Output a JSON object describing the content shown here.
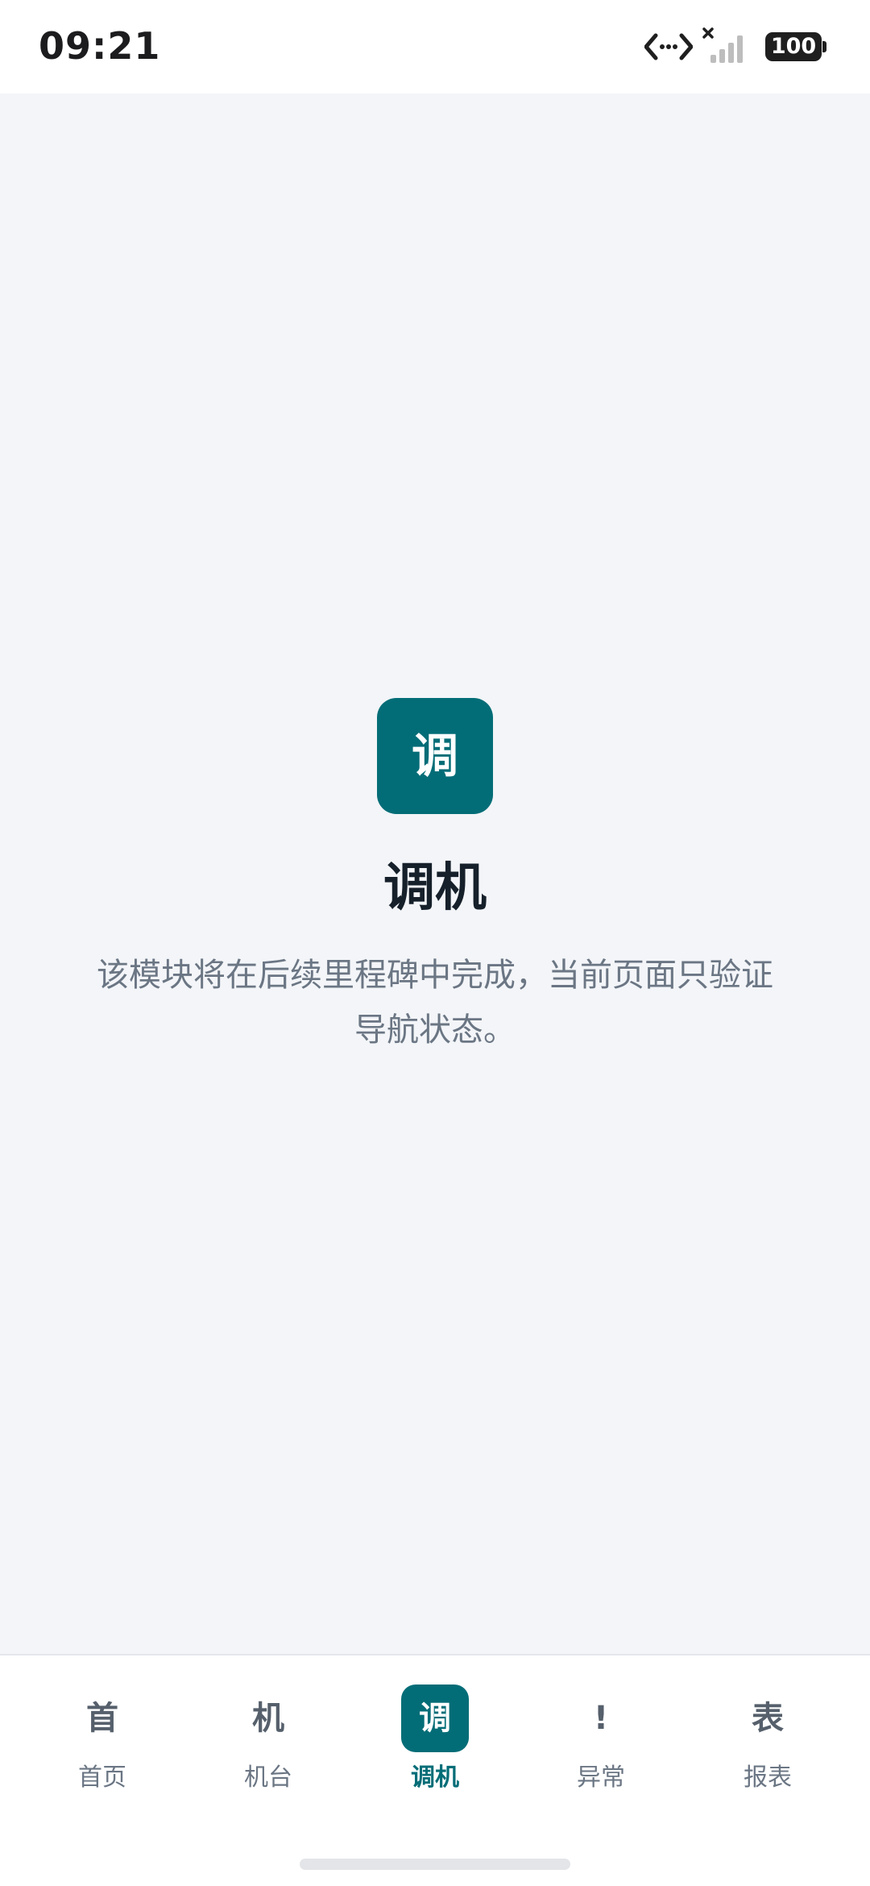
{
  "status_bar": {
    "time": "09:21",
    "battery": "100",
    "icons": [
      "data-transfer-icon",
      "signal-icon",
      "battery-icon"
    ]
  },
  "module": {
    "icon_char": "调",
    "title": "调机",
    "description": "该模块将在后续里程碑中完成，当前页面只验证导航状态。"
  },
  "nav": {
    "items": [
      {
        "glyph": "首",
        "label": "首页",
        "active": false
      },
      {
        "glyph": "机",
        "label": "机台",
        "active": false
      },
      {
        "glyph": "调",
        "label": "调机",
        "active": true
      },
      {
        "glyph": "!",
        "label": "异常",
        "active": false
      },
      {
        "glyph": "表",
        "label": "报表",
        "active": false
      }
    ]
  },
  "colors": {
    "accent": "#036d77",
    "background": "#f3f5f8",
    "text_primary": "#16202b",
    "text_secondary": "#6b7684"
  }
}
